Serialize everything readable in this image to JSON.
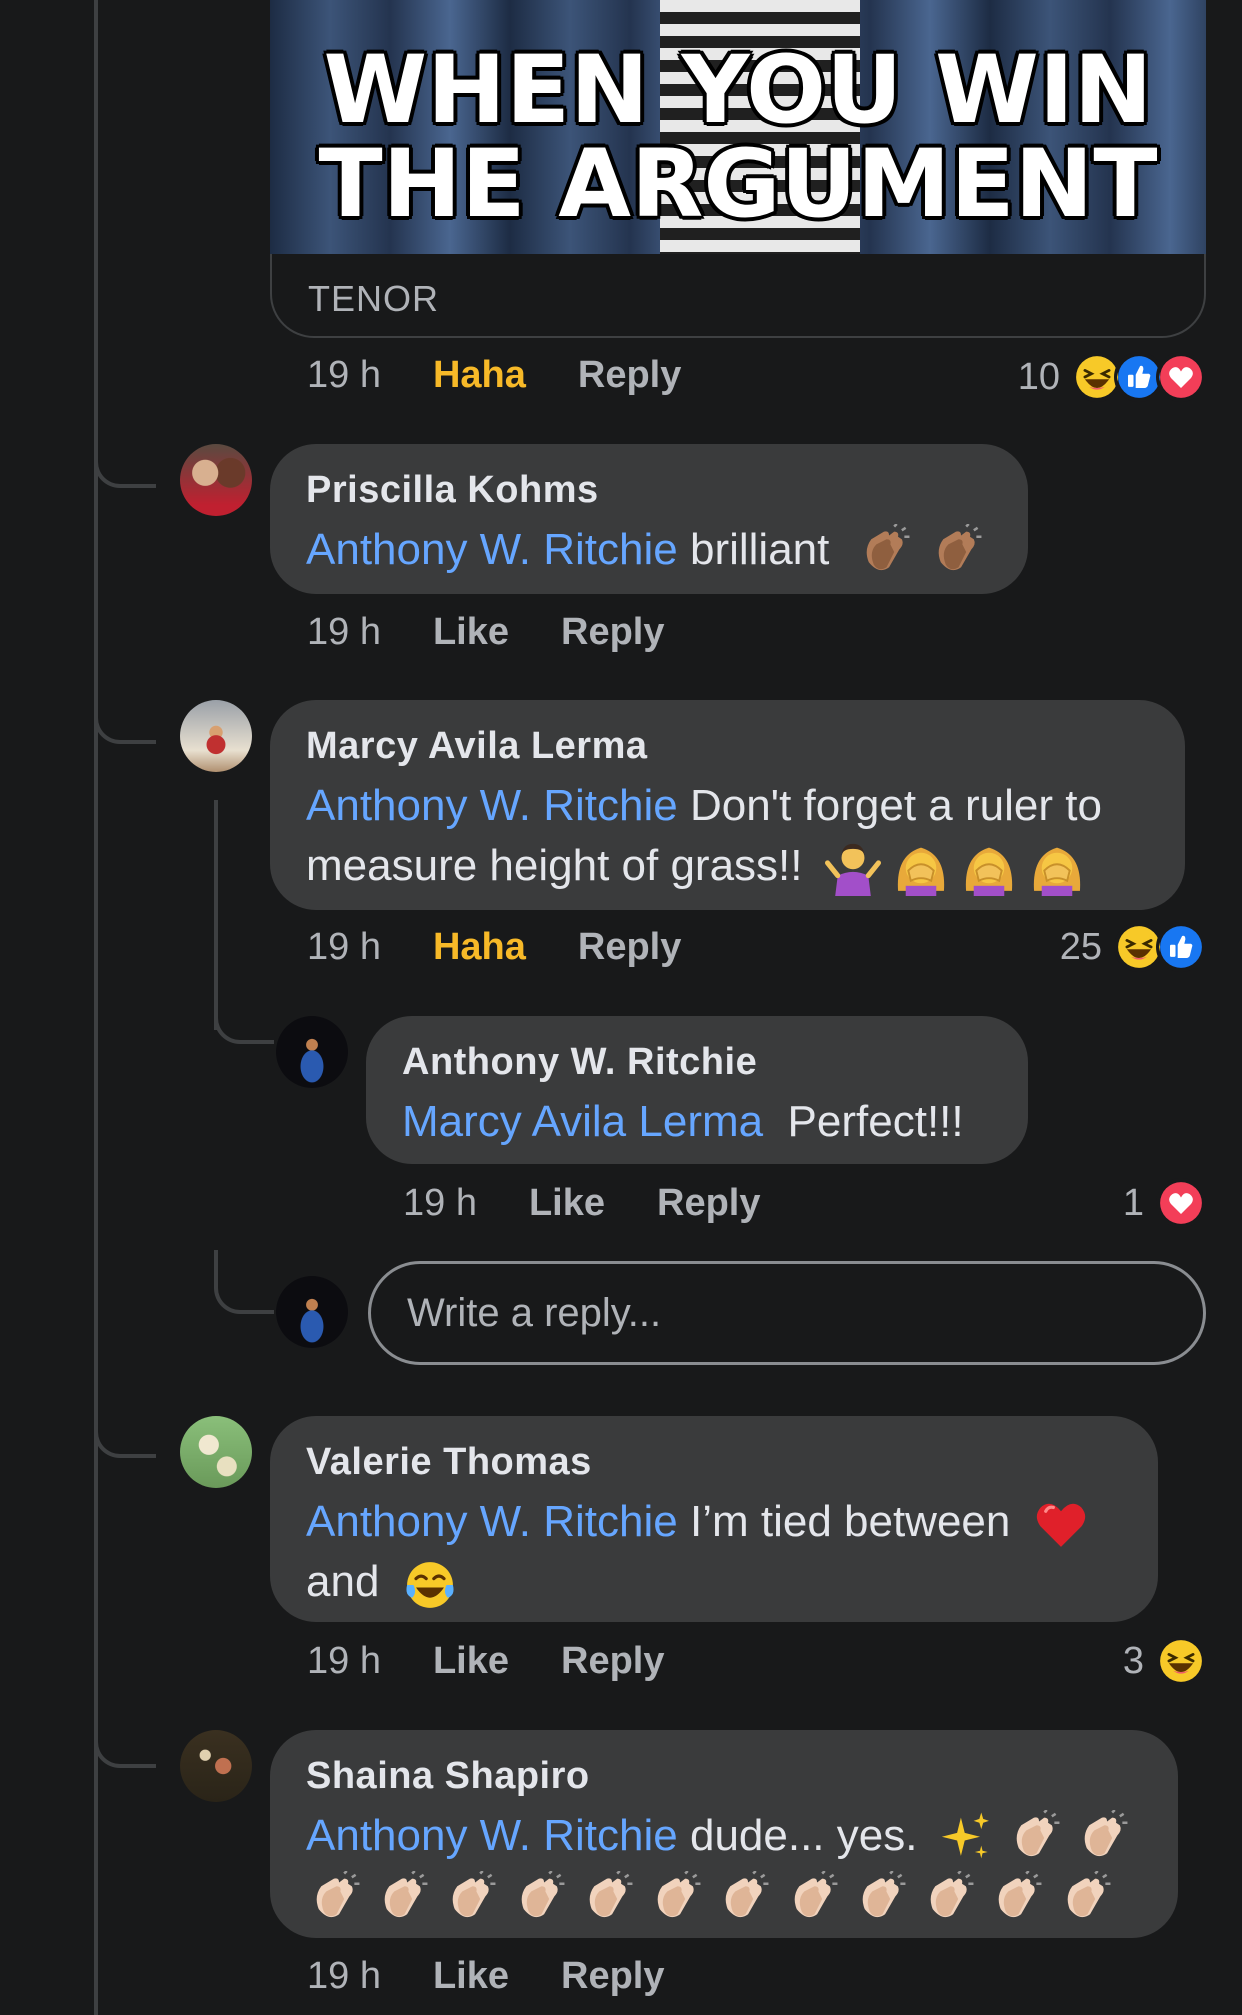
{
  "gif": {
    "caption_line1": "WHEN YOU WIN",
    "caption_line2": "THE ARGUMENT",
    "source": "TENOR",
    "time": "19 h",
    "action": "Haha",
    "reply": "Reply",
    "reaction_count": "10"
  },
  "comments": [
    {
      "author": "Priscilla Kohms",
      "mention": "Anthony W. Ritchie",
      "text": "brilliant",
      "time": "19 h",
      "action": "Like",
      "reply": "Reply"
    },
    {
      "author": "Marcy Avila Lerma",
      "mention": "Anthony W. Ritchie",
      "text": "Don't forget a ruler to",
      "text2": "measure height of grass!!",
      "time": "19 h",
      "action": "Haha",
      "reply": "Reply",
      "reaction_count": "25"
    },
    {
      "author": "Anthony W. Ritchie",
      "mention": "Marcy Avila Lerma",
      "text": "Perfect!!!",
      "time": "19 h",
      "action": "Like",
      "reply": "Reply",
      "reaction_count": "1"
    },
    {
      "author": "Valerie Thomas",
      "mention": "Anthony W. Ritchie",
      "text": "I’m tied between",
      "text2": "and",
      "time": "19 h",
      "action": "Like",
      "reply": "Reply",
      "reaction_count": "3"
    },
    {
      "author": "Shaina Shapiro",
      "mention": "Anthony W. Ritchie",
      "text": "dude... yes.",
      "time": "19 h",
      "action": "Like",
      "reply": "Reply"
    }
  ],
  "reply_box": {
    "placeholder": "Write a reply..."
  },
  "colors": {
    "background": "#18191a",
    "bubble": "#3a3b3c",
    "mention": "#66a6ff",
    "haha_active": "#f7b928",
    "like_blue": "#1877f2",
    "love_red": "#f33e58"
  },
  "icons": [
    "haha-emoji-icon",
    "like-thumb-icon",
    "love-heart-icon",
    "clapping-hands-emoji",
    "woman-shrugging-emoji",
    "face-palm-emoji",
    "red-heart-emoji",
    "tears-of-joy-emoji",
    "sparkles-emoji"
  ]
}
